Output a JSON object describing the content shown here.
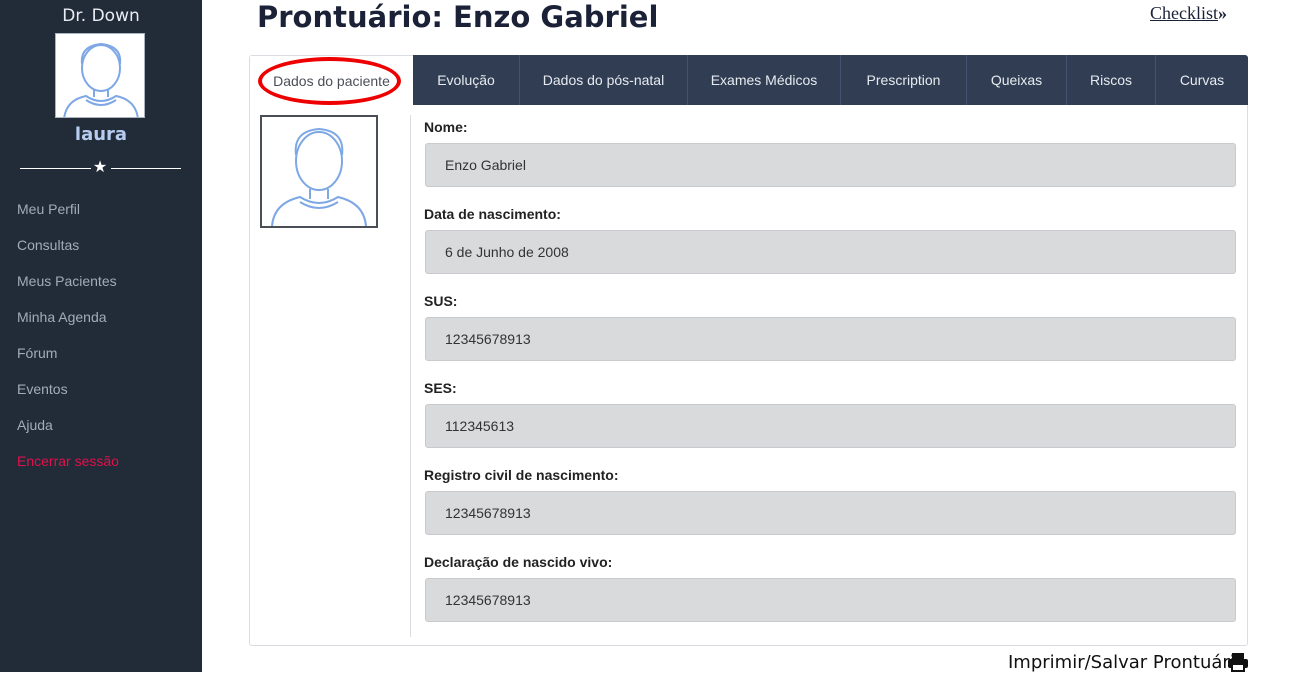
{
  "sidebar": {
    "brand": "Dr. Down",
    "username": "laura",
    "items": [
      {
        "label": "Meu Perfil"
      },
      {
        "label": "Consultas"
      },
      {
        "label": "Meus Pacientes"
      },
      {
        "label": "Minha Agenda"
      },
      {
        "label": "Fórum"
      },
      {
        "label": "Eventos"
      },
      {
        "label": "Ajuda"
      },
      {
        "label": "Encerrar sessão"
      }
    ]
  },
  "header": {
    "title": "Prontuário: Enzo Gabriel",
    "checklist": "Checklist"
  },
  "tabs": [
    {
      "label": "Dados do paciente",
      "active": true
    },
    {
      "label": "Evolução"
    },
    {
      "label": "Dados do pós-natal"
    },
    {
      "label": "Exames Médicos"
    },
    {
      "label": "Prescription"
    },
    {
      "label": "Queixas"
    },
    {
      "label": "Riscos"
    },
    {
      "label": "Curvas"
    }
  ],
  "fields": [
    {
      "label": "Nome:",
      "value": "Enzo Gabriel"
    },
    {
      "label": "Data de nascimento:",
      "value": "6 de Junho de 2008"
    },
    {
      "label": "SUS:",
      "value": "12345678913"
    },
    {
      "label": "SES:",
      "value": "112345613"
    },
    {
      "label": "Registro civil de nascimento:",
      "value": "12345678913"
    },
    {
      "label": "Declaração de nascido vivo:",
      "value": "12345678913"
    }
  ],
  "footer": {
    "print_label": "Imprimir/Salvar Prontuário"
  },
  "icons": {
    "avatar": "user-avatar-icon",
    "star": "star-icon",
    "checklist": "double-chevron-right-icon",
    "print": "printer-icon"
  },
  "colors": {
    "sidebar_bg": "#222b38",
    "tabbar_bg": "#303d52",
    "logout": "#e0114b",
    "username": "#b7cdf0",
    "annotation": "#ee0000",
    "avatar_stroke": "#7ea7e6"
  }
}
